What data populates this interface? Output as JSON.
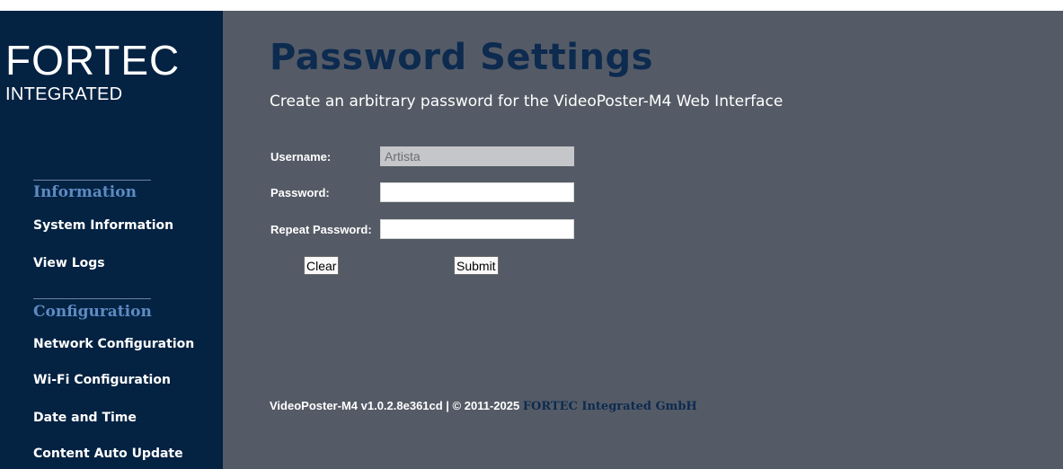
{
  "sidebar": {
    "logo": {
      "main": "FORTEC",
      "sub": "INTEGRATED"
    },
    "sections": [
      {
        "heading": "Information",
        "links": [
          "System Information",
          "View Logs"
        ]
      },
      {
        "heading": "Configuration",
        "links": [
          "Network Configuration",
          "Wi-Fi Configuration",
          "Date and Time",
          "Content Auto Update"
        ]
      }
    ]
  },
  "main": {
    "title": "Password Settings",
    "subtitle": "Create an arbitrary password for the VideoPoster-M4 Web Interface",
    "form": {
      "username_label": "Username:",
      "username_value": "Artista",
      "password_label": "Password:",
      "password_value": "",
      "repeat_label": "Repeat Password:",
      "repeat_value": "",
      "clear_label": "Clear",
      "submit_label": "Submit"
    },
    "footer": {
      "text": "VideoPoster-M4 v1.0.2.8e361cd | © 2011-2025 ",
      "brand": "FORTEC Integrated GmbH"
    }
  },
  "colors": {
    "sidebar_bg": "#042242",
    "main_bg": "#545b66",
    "title": "#0d2a4f",
    "section_heading": "#5d8bc3"
  }
}
